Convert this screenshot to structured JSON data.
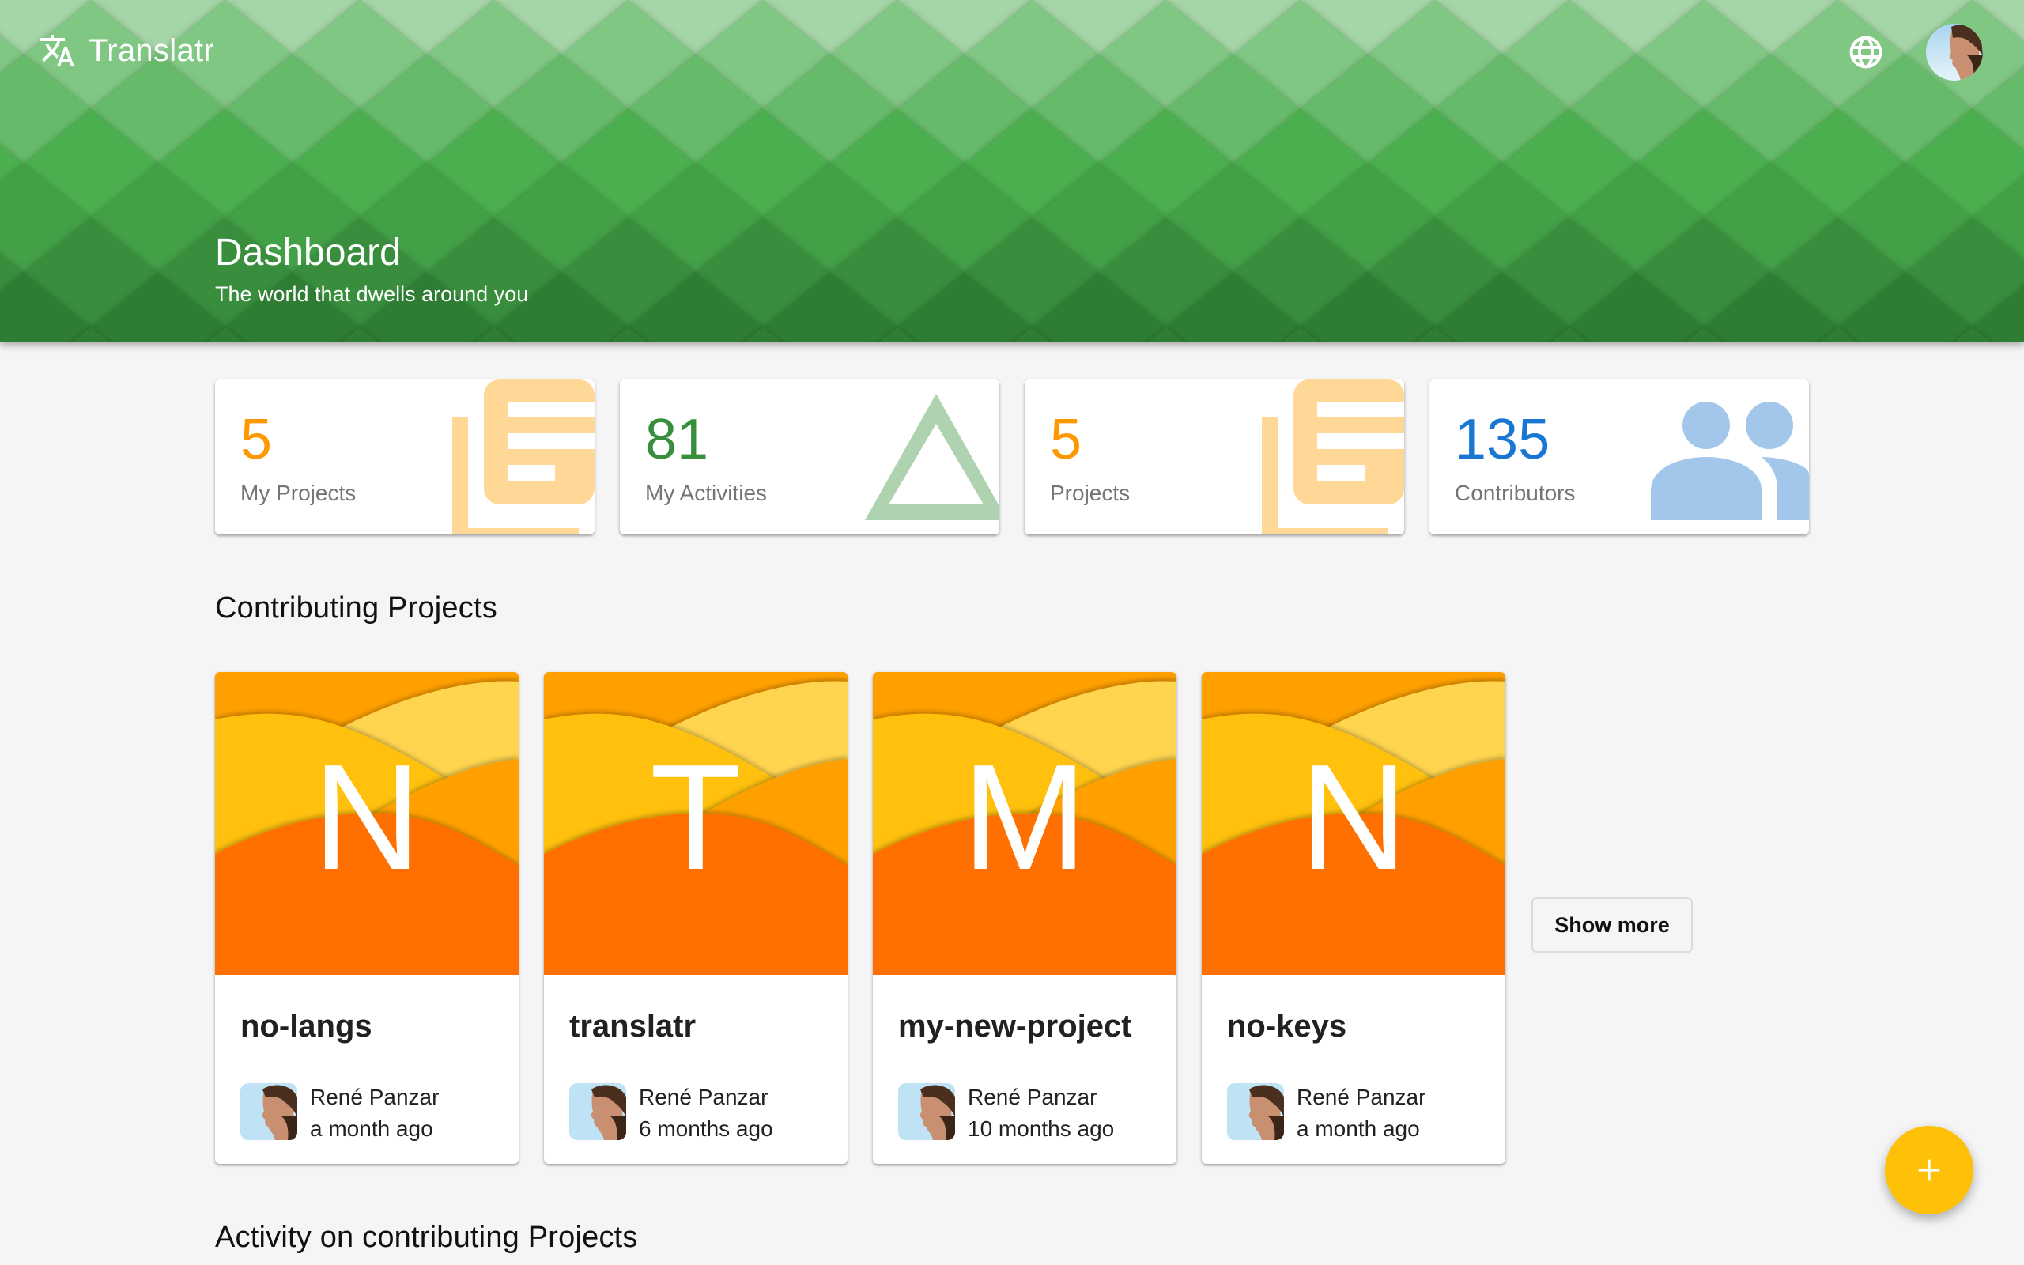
{
  "app": {
    "title": "Translatr",
    "logo_icon": "translate-icon",
    "language_icon": "globe-icon",
    "user_avatar": "user-avatar"
  },
  "header": {
    "title": "Dashboard",
    "subtitle": "The world that dwells around you",
    "pattern_colors": [
      "#a5d6a7",
      "#81c784",
      "#66bb6a",
      "#4caf50",
      "#43a047",
      "#388e3c",
      "#2e7d32"
    ]
  },
  "stats": [
    {
      "value": "5",
      "label": "My Projects",
      "icon": "library-books-icon",
      "color": "#ff9800",
      "icon_color": "#ffd897"
    },
    {
      "value": "81",
      "label": "My Activities",
      "icon": "triangle-outline-icon",
      "color": "#388e3c",
      "icon_color": "#afd3b1"
    },
    {
      "value": "5",
      "label": "Projects",
      "icon": "library-books-icon",
      "color": "#ff9800",
      "icon_color": "#ffd897"
    },
    {
      "value": "135",
      "label": "Contributors",
      "icon": "people-icon",
      "color": "#1976d2",
      "icon_color": "#a2c7eb"
    }
  ],
  "sections": {
    "contributing_projects": "Contributing Projects",
    "activity": "Activity on contributing Projects"
  },
  "projects": [
    {
      "letter": "N",
      "name": "no-langs",
      "owner": "René Panzar",
      "updated": "a month ago"
    },
    {
      "letter": "T",
      "name": "translatr",
      "owner": "René Panzar",
      "updated": "6 months ago"
    },
    {
      "letter": "M",
      "name": "my-new-project",
      "owner": "René Panzar",
      "updated": "10 months ago"
    },
    {
      "letter": "N",
      "name": "no-keys",
      "owner": "René Panzar",
      "updated": "a month ago"
    }
  ],
  "actions": {
    "show_more": "Show more",
    "fab_icon": "plus-icon"
  }
}
